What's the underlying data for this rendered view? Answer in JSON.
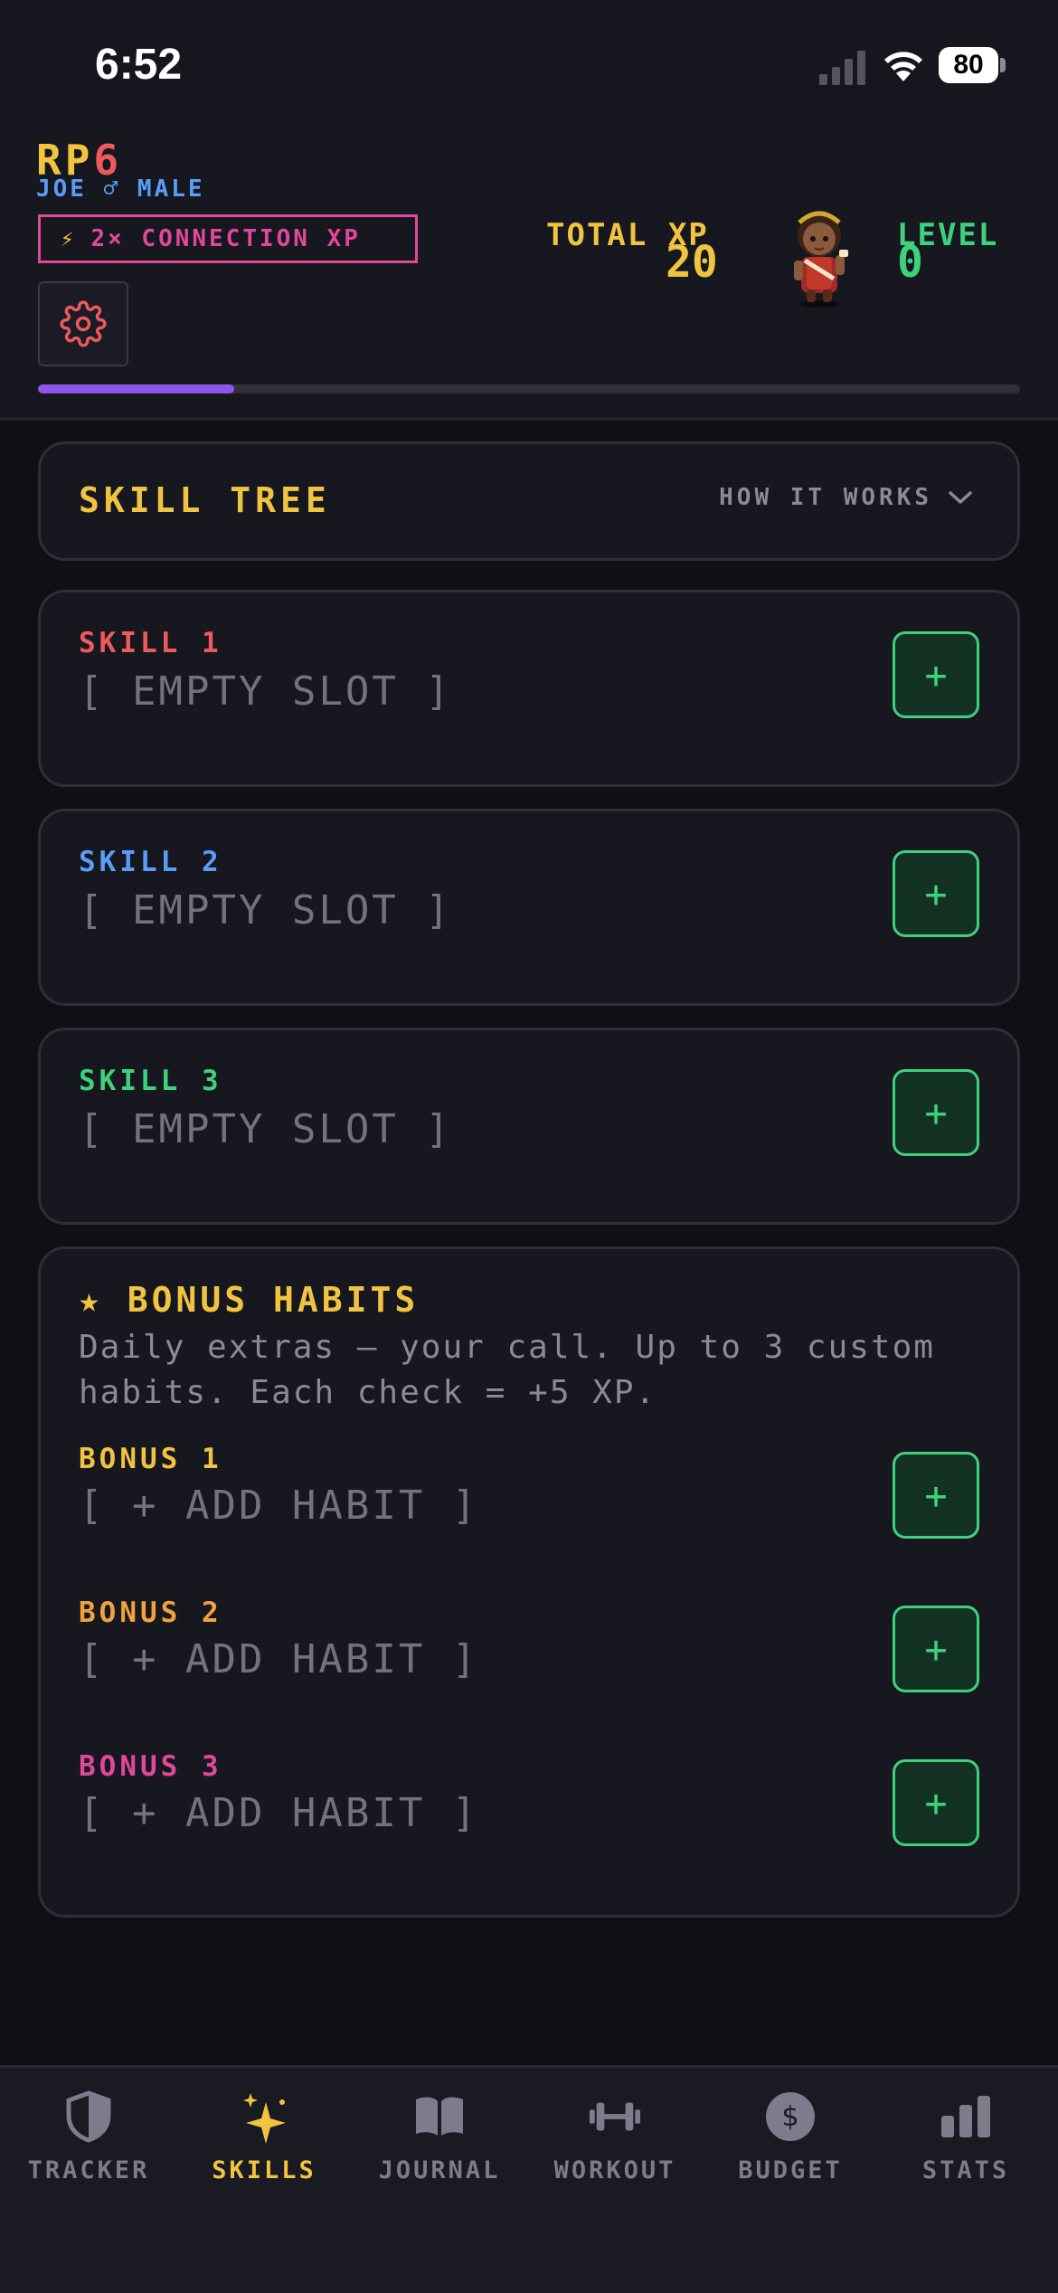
{
  "status_bar": {
    "time": "6:52",
    "battery": "80"
  },
  "header": {
    "logo_part1": "RP",
    "logo_part2": "6",
    "user_line": "JOE ♂ MALE",
    "boost_icon": "⚡",
    "boost_label": "2× CONNECTION XP",
    "settings_icon": "gear-icon",
    "total_xp_label": "TOTAL XP",
    "total_xp_value": "20",
    "level_label": "LEVEL",
    "level_value": "0",
    "xp_progress_fraction": 0.2
  },
  "skill_tree": {
    "title": "SKILL TREE",
    "how_it_works": "HOW IT WORKS"
  },
  "skills": [
    {
      "label": "SKILL 1",
      "value": "[ EMPTY SLOT ]",
      "color": "#ee5a5a",
      "button": "+"
    },
    {
      "label": "SKILL 2",
      "value": "[ EMPTY SLOT ]",
      "color": "#5a9df7",
      "button": "+"
    },
    {
      "label": "SKILL 3",
      "value": "[ EMPTY SLOT ]",
      "color": "#3ed17b",
      "button": "+"
    }
  ],
  "bonus_habits": {
    "title": "★ BONUS HABITS",
    "description": "Daily extras — your call. Up to 3 custom habits. Each check = +5 XP.",
    "items": [
      {
        "label": "BONUS 1",
        "value": "[ + ADD HABIT ]",
        "color": "#f0c341",
        "button": "+"
      },
      {
        "label": "BONUS 2",
        "value": "[ + ADD HABIT ]",
        "color": "#f0a33a",
        "button": "+"
      },
      {
        "label": "BONUS 3",
        "value": "[ + ADD HABIT ]",
        "color": "#e0489b",
        "button": "+"
      }
    ]
  },
  "tabs": [
    {
      "label": "TRACKER",
      "icon": "shield-icon"
    },
    {
      "label": "SKILLS",
      "icon": "sparkles-icon",
      "active": true
    },
    {
      "label": "JOURNAL",
      "icon": "book-icon"
    },
    {
      "label": "WORKOUT",
      "icon": "dumbbell-icon"
    },
    {
      "label": "BUDGET",
      "icon": "dollar-icon"
    },
    {
      "label": "STATS",
      "icon": "bar-chart-icon"
    }
  ],
  "colors": {
    "accent_yellow": "#f0c341",
    "accent_green": "#3ed17b",
    "accent_pink": "#e0489b",
    "accent_blue": "#5a9df7",
    "progress_purple": "#8e56e8"
  }
}
